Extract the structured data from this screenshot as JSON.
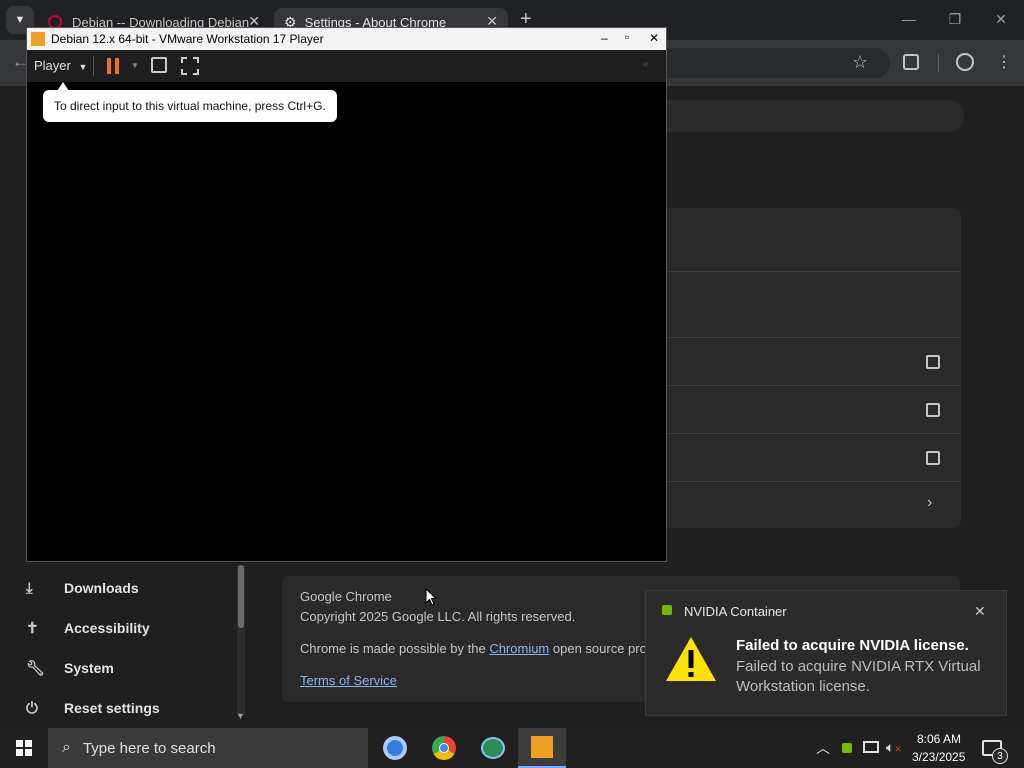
{
  "chrome": {
    "tabs": [
      {
        "label": "Debian -- Downloading Debian"
      },
      {
        "label": "Settings - About Chrome"
      }
    ],
    "new_tab": "+",
    "window_controls": {
      "minimize": "—",
      "maximize": "❐",
      "close": "✕"
    }
  },
  "vmware": {
    "title": "Debian 12.x 64-bit - VMware Workstation 17 Player",
    "player_menu": "Player",
    "controls": {
      "min": "–",
      "max": "▫",
      "close": "✕"
    },
    "tip": "To direct input to this virtual machine, press Ctrl+G."
  },
  "sidebar": {
    "items": [
      {
        "label": "Downloads",
        "icon": "download-icon"
      },
      {
        "label": "Accessibility",
        "icon": "accessibility-icon"
      },
      {
        "label": "System",
        "icon": "wrench-icon"
      },
      {
        "label": "Reset settings",
        "icon": "reset-icon"
      }
    ]
  },
  "about": {
    "product": "Google Chrome",
    "copyright": "Copyright 2025 Google LLC. All rights reserved.",
    "made_possible_prefix": "Chrome is made possible by the ",
    "chromium_link": "Chromium",
    "made_possible_suffix": " open source proj",
    "tos_link": "Terms of Service"
  },
  "notification": {
    "app": "NVIDIA Container",
    "title": "Failed to acquire NVIDIA license.",
    "body": "Failed to acquire NVIDIA RTX Virtual Workstation license.",
    "close": "✕"
  },
  "taskbar": {
    "search_placeholder": "Type here to search",
    "time": "8:06 AM",
    "date": "3/23/2025",
    "notification_count": "3"
  },
  "colors": {
    "accent_link": "#8ab4f8",
    "warning": "#fde100",
    "pause": "#e8711a"
  }
}
